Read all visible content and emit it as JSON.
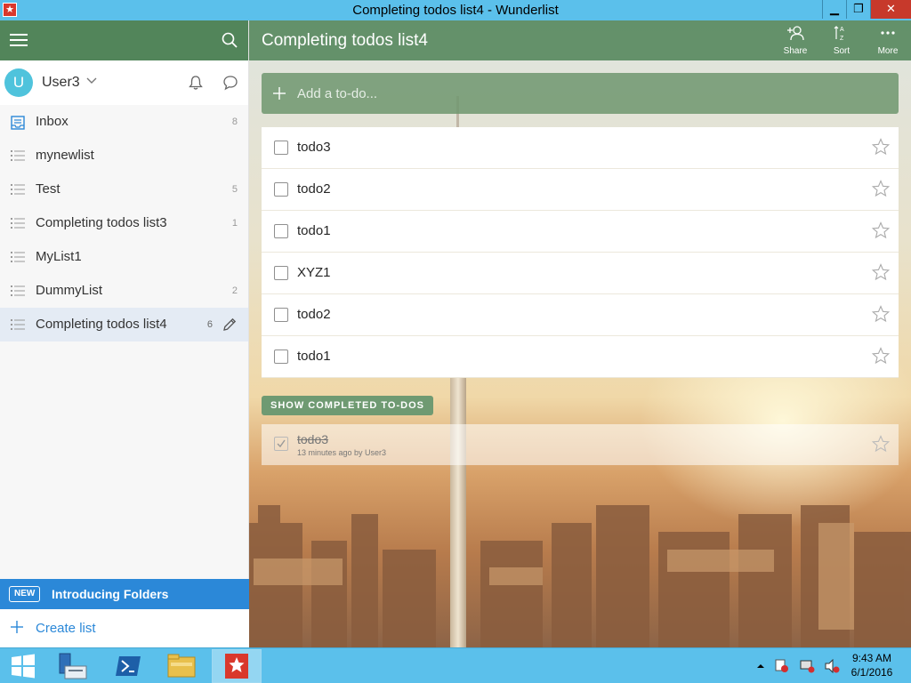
{
  "window": {
    "title": "Completing todos list4 - Wunderlist",
    "minimize": "▁",
    "maximize": "❐",
    "close": "✕"
  },
  "sidebar": {
    "user": {
      "initial": "U",
      "name": "User3"
    },
    "lists": [
      {
        "label": "Inbox",
        "count": "8",
        "icon": "inbox-icon"
      },
      {
        "label": "mynewlist",
        "count": "",
        "icon": "list-icon"
      },
      {
        "label": "Test",
        "count": "5",
        "icon": "list-icon"
      },
      {
        "label": "Completing todos list3",
        "count": "1",
        "icon": "list-icon"
      },
      {
        "label": "MyList1",
        "count": "",
        "icon": "list-icon"
      },
      {
        "label": "DummyList",
        "count": "2",
        "icon": "list-icon"
      },
      {
        "label": "Completing todos list4",
        "count": "6",
        "icon": "list-icon",
        "active": true
      }
    ],
    "banner": {
      "badge": "NEW",
      "text": "Introducing Folders"
    },
    "create_list": "Create list"
  },
  "main": {
    "title": "Completing todos list4",
    "actions": [
      {
        "label": "Share",
        "icon": "share-icon"
      },
      {
        "label": "Sort",
        "icon": "sort-icon"
      },
      {
        "label": "More",
        "icon": "more-icon"
      }
    ],
    "add_placeholder": "Add a to-do...",
    "todos": [
      "todo3",
      "todo2",
      "todo1",
      "XYZ1",
      "todo2",
      "todo1"
    ],
    "show_completed": "SHOW COMPLETED TO-DOS",
    "completed": [
      {
        "label": "todo3",
        "meta": "13 minutes ago by User3"
      }
    ]
  },
  "taskbar": {
    "clock_time": "9:43 AM",
    "clock_date": "6/1/2016"
  },
  "colors": {
    "accent_green": "#52855a",
    "accent_blue": "#2b88d8",
    "titlebar": "#5bc0eb"
  }
}
